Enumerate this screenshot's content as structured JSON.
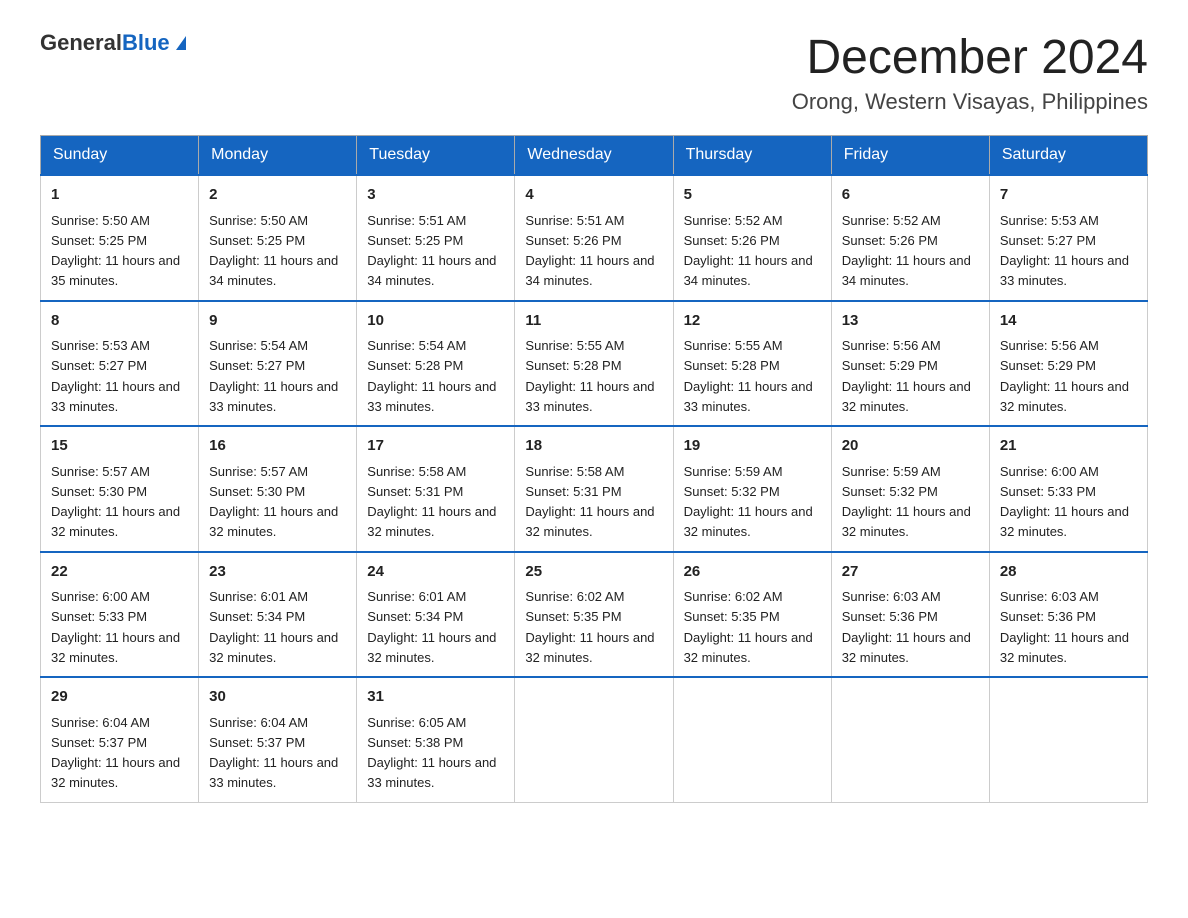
{
  "header": {
    "logo_general": "General",
    "logo_blue": "Blue",
    "month_title": "December 2024",
    "location": "Orong, Western Visayas, Philippines"
  },
  "days_of_week": [
    "Sunday",
    "Monday",
    "Tuesday",
    "Wednesday",
    "Thursday",
    "Friday",
    "Saturday"
  ],
  "weeks": [
    [
      {
        "day": "1",
        "sunrise": "5:50 AM",
        "sunset": "5:25 PM",
        "daylight": "11 hours and 35 minutes."
      },
      {
        "day": "2",
        "sunrise": "5:50 AM",
        "sunset": "5:25 PM",
        "daylight": "11 hours and 34 minutes."
      },
      {
        "day": "3",
        "sunrise": "5:51 AM",
        "sunset": "5:25 PM",
        "daylight": "11 hours and 34 minutes."
      },
      {
        "day": "4",
        "sunrise": "5:51 AM",
        "sunset": "5:26 PM",
        "daylight": "11 hours and 34 minutes."
      },
      {
        "day": "5",
        "sunrise": "5:52 AM",
        "sunset": "5:26 PM",
        "daylight": "11 hours and 34 minutes."
      },
      {
        "day": "6",
        "sunrise": "5:52 AM",
        "sunset": "5:26 PM",
        "daylight": "11 hours and 34 minutes."
      },
      {
        "day": "7",
        "sunrise": "5:53 AM",
        "sunset": "5:27 PM",
        "daylight": "11 hours and 33 minutes."
      }
    ],
    [
      {
        "day": "8",
        "sunrise": "5:53 AM",
        "sunset": "5:27 PM",
        "daylight": "11 hours and 33 minutes."
      },
      {
        "day": "9",
        "sunrise": "5:54 AM",
        "sunset": "5:27 PM",
        "daylight": "11 hours and 33 minutes."
      },
      {
        "day": "10",
        "sunrise": "5:54 AM",
        "sunset": "5:28 PM",
        "daylight": "11 hours and 33 minutes."
      },
      {
        "day": "11",
        "sunrise": "5:55 AM",
        "sunset": "5:28 PM",
        "daylight": "11 hours and 33 minutes."
      },
      {
        "day": "12",
        "sunrise": "5:55 AM",
        "sunset": "5:28 PM",
        "daylight": "11 hours and 33 minutes."
      },
      {
        "day": "13",
        "sunrise": "5:56 AM",
        "sunset": "5:29 PM",
        "daylight": "11 hours and 32 minutes."
      },
      {
        "day": "14",
        "sunrise": "5:56 AM",
        "sunset": "5:29 PM",
        "daylight": "11 hours and 32 minutes."
      }
    ],
    [
      {
        "day": "15",
        "sunrise": "5:57 AM",
        "sunset": "5:30 PM",
        "daylight": "11 hours and 32 minutes."
      },
      {
        "day": "16",
        "sunrise": "5:57 AM",
        "sunset": "5:30 PM",
        "daylight": "11 hours and 32 minutes."
      },
      {
        "day": "17",
        "sunrise": "5:58 AM",
        "sunset": "5:31 PM",
        "daylight": "11 hours and 32 minutes."
      },
      {
        "day": "18",
        "sunrise": "5:58 AM",
        "sunset": "5:31 PM",
        "daylight": "11 hours and 32 minutes."
      },
      {
        "day": "19",
        "sunrise": "5:59 AM",
        "sunset": "5:32 PM",
        "daylight": "11 hours and 32 minutes."
      },
      {
        "day": "20",
        "sunrise": "5:59 AM",
        "sunset": "5:32 PM",
        "daylight": "11 hours and 32 minutes."
      },
      {
        "day": "21",
        "sunrise": "6:00 AM",
        "sunset": "5:33 PM",
        "daylight": "11 hours and 32 minutes."
      }
    ],
    [
      {
        "day": "22",
        "sunrise": "6:00 AM",
        "sunset": "5:33 PM",
        "daylight": "11 hours and 32 minutes."
      },
      {
        "day": "23",
        "sunrise": "6:01 AM",
        "sunset": "5:34 PM",
        "daylight": "11 hours and 32 minutes."
      },
      {
        "day": "24",
        "sunrise": "6:01 AM",
        "sunset": "5:34 PM",
        "daylight": "11 hours and 32 minutes."
      },
      {
        "day": "25",
        "sunrise": "6:02 AM",
        "sunset": "5:35 PM",
        "daylight": "11 hours and 32 minutes."
      },
      {
        "day": "26",
        "sunrise": "6:02 AM",
        "sunset": "5:35 PM",
        "daylight": "11 hours and 32 minutes."
      },
      {
        "day": "27",
        "sunrise": "6:03 AM",
        "sunset": "5:36 PM",
        "daylight": "11 hours and 32 minutes."
      },
      {
        "day": "28",
        "sunrise": "6:03 AM",
        "sunset": "5:36 PM",
        "daylight": "11 hours and 32 minutes."
      }
    ],
    [
      {
        "day": "29",
        "sunrise": "6:04 AM",
        "sunset": "5:37 PM",
        "daylight": "11 hours and 32 minutes."
      },
      {
        "day": "30",
        "sunrise": "6:04 AM",
        "sunset": "5:37 PM",
        "daylight": "11 hours and 33 minutes."
      },
      {
        "day": "31",
        "sunrise": "6:05 AM",
        "sunset": "5:38 PM",
        "daylight": "11 hours and 33 minutes."
      },
      null,
      null,
      null,
      null
    ]
  ]
}
